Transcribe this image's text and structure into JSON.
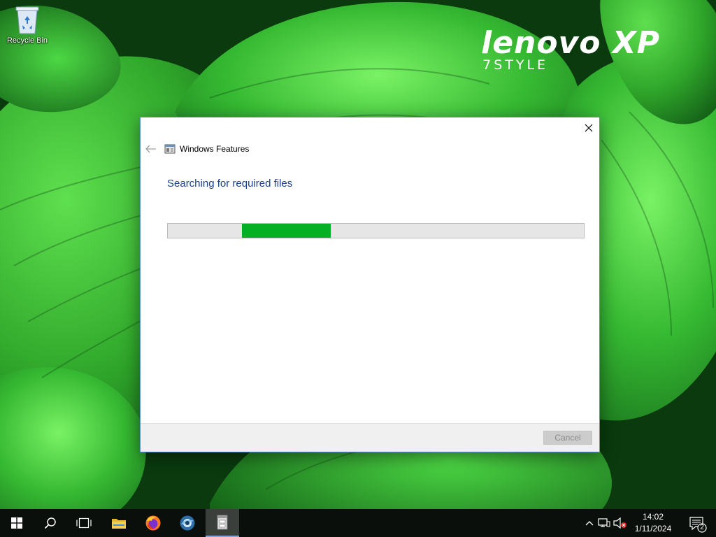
{
  "desktop": {
    "wallpaper_brand": {
      "main": "lenovo XP",
      "sub": "7STYLE"
    },
    "icons": [
      {
        "label": "Recycle Bin",
        "icon": "recycle-bin-icon"
      }
    ]
  },
  "dialog": {
    "app_title": "Windows Features",
    "status_heading": "Searching for required files",
    "progress": {
      "state": "indeterminate",
      "chunk_color": "#06b025"
    },
    "buttons": {
      "cancel_label": "Cancel",
      "cancel_enabled": false
    }
  },
  "taskbar": {
    "buttons": [
      {
        "name": "start-button",
        "icon": "windows-logo-icon"
      },
      {
        "name": "search-button",
        "icon": "search-icon"
      },
      {
        "name": "task-view-button",
        "icon": "task-view-icon"
      },
      {
        "name": "file-explorer-button",
        "icon": "folder-icon"
      },
      {
        "name": "firefox-button",
        "icon": "firefox-icon"
      },
      {
        "name": "browser-button",
        "icon": "globe-icon"
      },
      {
        "name": "windows-features-button",
        "icon": "windows-features-icon",
        "active": true
      }
    ],
    "tray": {
      "time": "14:02",
      "date": "1/11/2024",
      "notifications_count": "2",
      "icons": [
        "chevron-up-icon",
        "network-icon",
        "volume-muted-icon"
      ]
    }
  },
  "colors": {
    "accent": "#1a3f8a",
    "progress": "#06b025",
    "taskbar": "#0a0f0b"
  }
}
